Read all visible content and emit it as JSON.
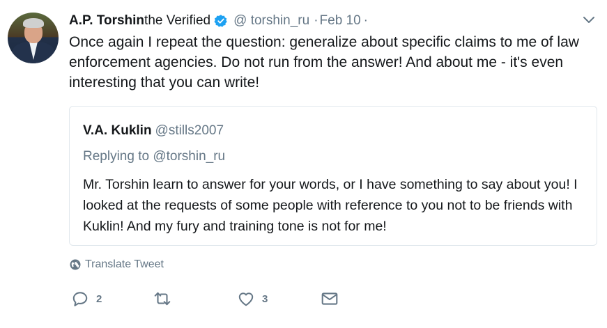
{
  "tweet": {
    "author": {
      "name": "A.P. Torshin",
      "name_suffix": "the Verified",
      "handle": "@ torshin_ru",
      "verified": true
    },
    "separator": "·",
    "date": "Feb 10",
    "trailing_dot": "·",
    "text": "Once again I repeat the question: generalize about specific claims to me of law enforcement agencies. Do not run from the answer! And about me - it's even interesting that you can write!",
    "quoted": {
      "name": "V.A. Kuklin",
      "handle": "@stills2007",
      "replying_to": "Replying to @torshin_ru",
      "text": "Mr. Torshin learn to answer for your words, or I have something to say about you! I looked at the requests of some people with reference to you not to be friends with Kuklin! And my fury and training tone is not for me!"
    },
    "translate_label": "Translate Tweet",
    "actions": {
      "reply_count": "2",
      "retweet_count": "",
      "like_count": "3"
    }
  },
  "icons": {
    "verified": "verified-badge-icon",
    "menu": "chevron-down-icon",
    "translate": "globe-icon",
    "reply": "reply-icon",
    "retweet": "retweet-icon",
    "like": "heart-icon",
    "message": "envelope-icon"
  },
  "colors": {
    "text": "#14171a",
    "secondary": "#657786",
    "verified": "#1da1f2",
    "border": "#e1e8ed"
  }
}
